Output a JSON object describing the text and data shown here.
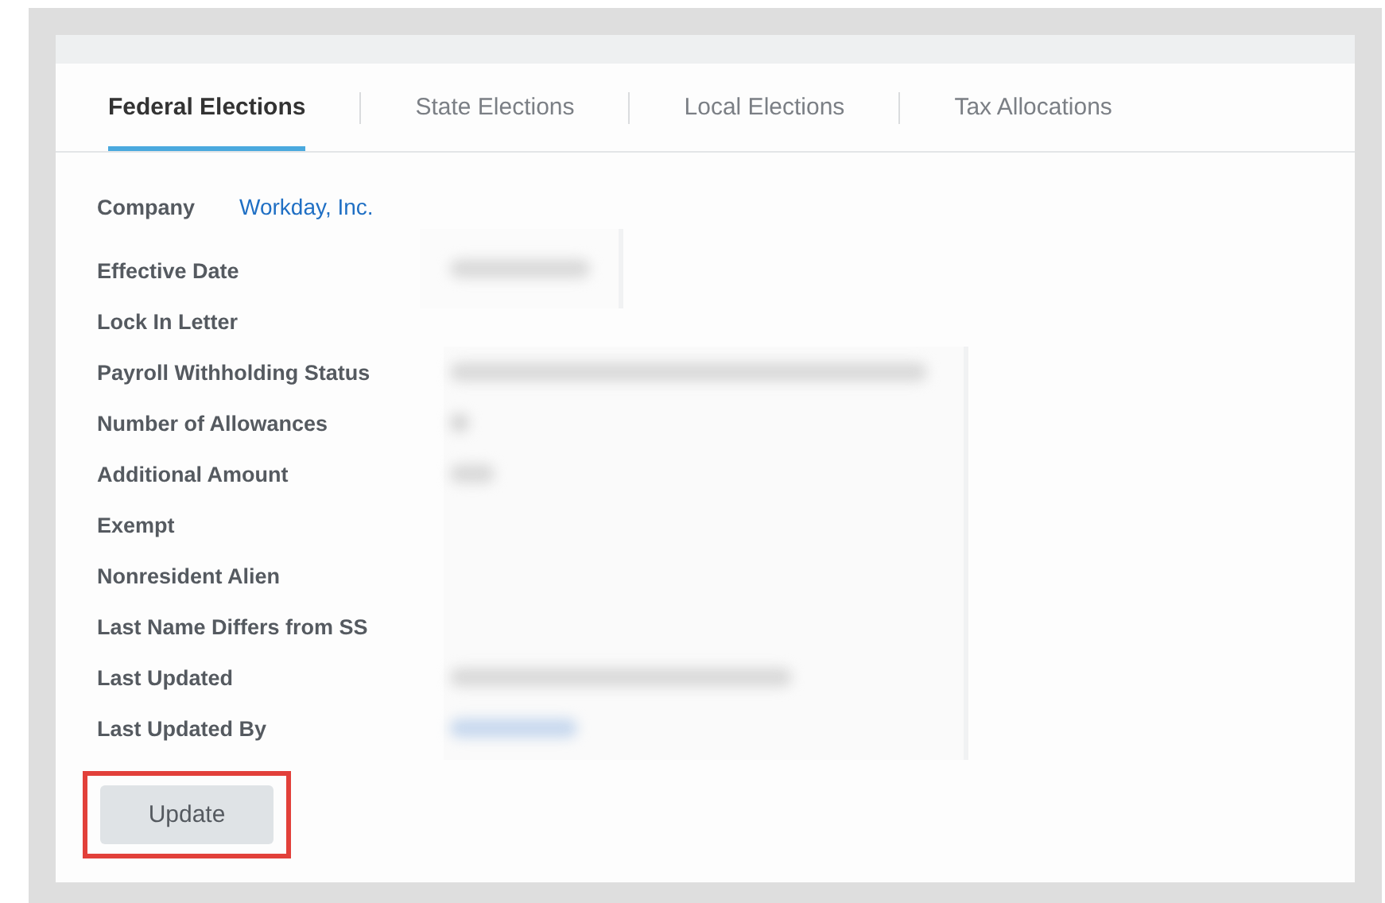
{
  "tabs": [
    {
      "label": "Federal Elections",
      "selected": true
    },
    {
      "label": "State Elections",
      "selected": false
    },
    {
      "label": "Local Elections",
      "selected": false
    },
    {
      "label": "Tax Allocations",
      "selected": false
    }
  ],
  "company": {
    "label": "Company",
    "value": "Workday, Inc."
  },
  "fields": [
    {
      "label": "Effective Date",
      "kind": "blur-date"
    },
    {
      "label": "Lock In Letter"
    },
    {
      "label": "Payroll Withholding Status",
      "kind": "blur-long"
    },
    {
      "label": "Number of Allowances",
      "kind": "blur-tiny"
    },
    {
      "label": "Additional Amount",
      "kind": "blur-short"
    },
    {
      "label": "Exempt"
    },
    {
      "label": "Nonresident Alien"
    },
    {
      "label": "Last Name Differs from SS"
    },
    {
      "label": "Last Updated",
      "kind": "blur-medium"
    },
    {
      "label": "Last Updated By",
      "kind": "blur-link"
    }
  ],
  "update_button": {
    "label": "Update",
    "highlighted": true
  }
}
